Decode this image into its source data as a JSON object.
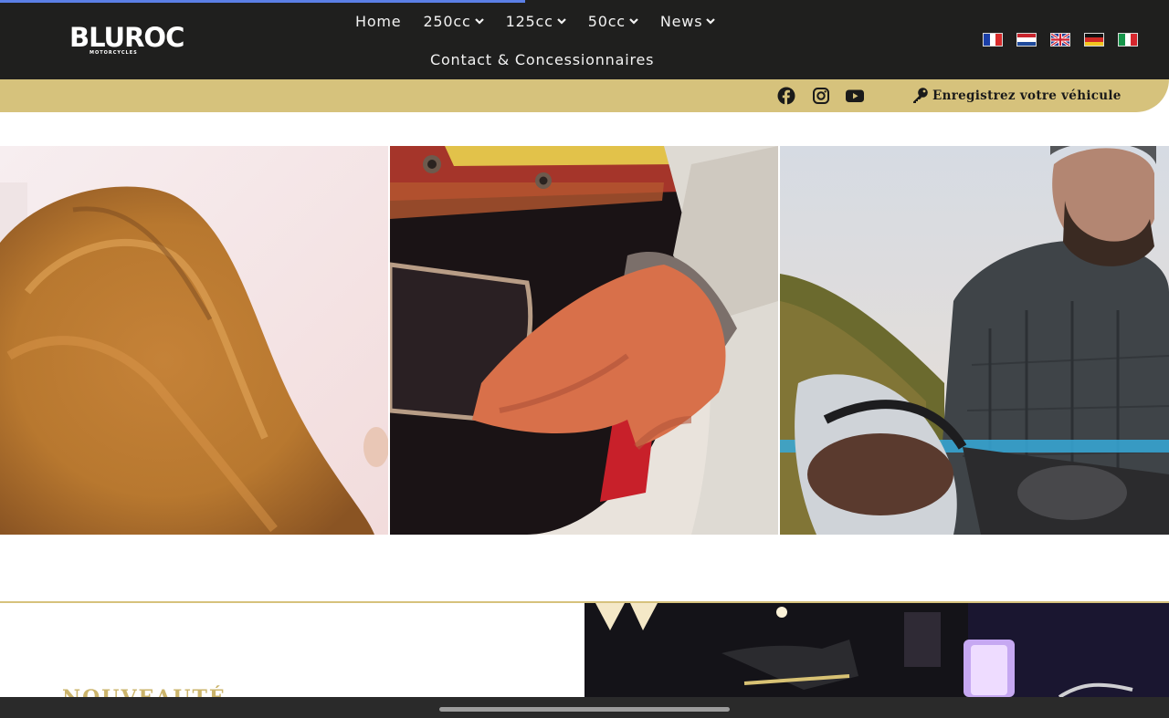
{
  "brand": {
    "logo_text": "BLUROC",
    "logo_sub": "MOTORCYCLES"
  },
  "nav": {
    "items": [
      {
        "label": "Home",
        "has_dropdown": false
      },
      {
        "label": "250cc",
        "has_dropdown": true
      },
      {
        "label": "125cc",
        "has_dropdown": true
      },
      {
        "label": "50cc",
        "has_dropdown": true
      },
      {
        "label": "News",
        "has_dropdown": true
      }
    ],
    "contact_label": "Contact & Concessionnaires"
  },
  "languages": [
    {
      "code": "fr",
      "flag": "france-flag-icon"
    },
    {
      "code": "nl",
      "flag": "netherlands-flag-icon"
    },
    {
      "code": "en",
      "flag": "uk-flag-icon"
    },
    {
      "code": "de",
      "flag": "germany-flag-icon"
    },
    {
      "code": "it",
      "flag": "italy-flag-icon"
    }
  ],
  "utility_bar": {
    "social": [
      "facebook-icon",
      "instagram-icon",
      "youtube-icon"
    ],
    "register_label": "Enregistrez votre véhicule",
    "register_icon": "key-icon"
  },
  "gallery": [
    {
      "alt": "woman-with-long-curly-hair-photo"
    },
    {
      "alt": "hand-holding-helmet-photo"
    },
    {
      "alt": "bearded-rider-on-motorcycle-photo"
    }
  ],
  "section": {
    "heading": "NOUVEAUTÉ"
  },
  "colors": {
    "header_bg": "#1f1f1e",
    "gold": "#d6c27c",
    "progress": "#5b7fe6"
  }
}
